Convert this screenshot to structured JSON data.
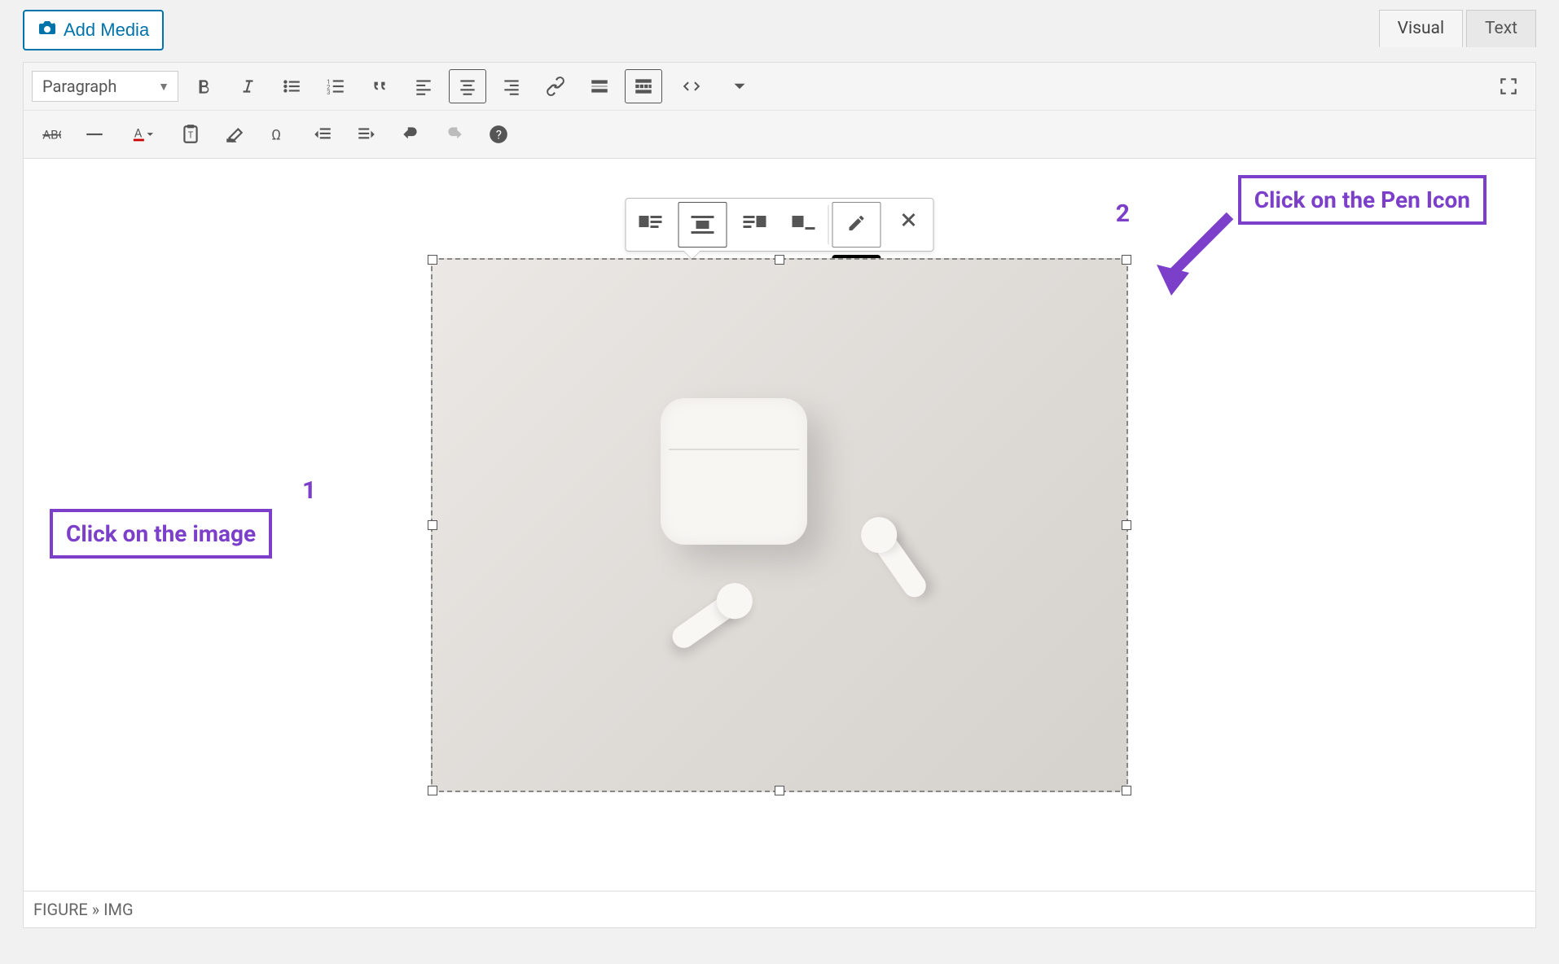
{
  "addMedia": {
    "label": "Add Media"
  },
  "tabs": {
    "visual": "Visual",
    "text": "Text"
  },
  "format": {
    "selected": "Paragraph"
  },
  "tooltip": {
    "edit": "Edit"
  },
  "annotations": {
    "step1_label": "Click on the image",
    "step1_num": "1",
    "step2_label": "Click on the Pen Icon",
    "step2_num": "2"
  },
  "statusBar": "FIGURE » IMG",
  "colors": {
    "accent": "#0073aa",
    "annotation": "#7b3fc9"
  }
}
